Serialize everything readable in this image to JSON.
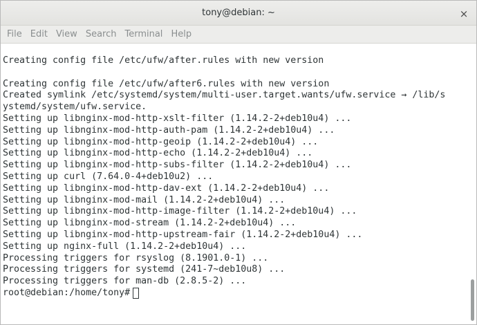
{
  "window": {
    "title": "tony@debian: ~",
    "close_glyph": "×"
  },
  "menu": {
    "items": [
      "File",
      "Edit",
      "View",
      "Search",
      "Terminal",
      "Help"
    ]
  },
  "terminal": {
    "lines": [
      "Creating config file /etc/ufw/after.rules with new version",
      "",
      "Creating config file /etc/ufw/after6.rules with new version",
      "Created symlink /etc/systemd/system/multi-user.target.wants/ufw.service → /lib/s",
      "ystemd/system/ufw.service.",
      "Setting up libnginx-mod-http-xslt-filter (1.14.2-2+deb10u4) ...",
      "Setting up libnginx-mod-http-auth-pam (1.14.2-2+deb10u4) ...",
      "Setting up libnginx-mod-http-geoip (1.14.2-2+deb10u4) ...",
      "Setting up libnginx-mod-http-echo (1.14.2-2+deb10u4) ...",
      "Setting up libnginx-mod-http-subs-filter (1.14.2-2+deb10u4) ...",
      "Setting up curl (7.64.0-4+deb10u2) ...",
      "Setting up libnginx-mod-http-dav-ext (1.14.2-2+deb10u4) ...",
      "Setting up libnginx-mod-mail (1.14.2-2+deb10u4) ...",
      "Setting up libnginx-mod-http-image-filter (1.14.2-2+deb10u4) ...",
      "Setting up libnginx-mod-stream (1.14.2-2+deb10u4) ...",
      "Setting up libnginx-mod-http-upstream-fair (1.14.2-2+deb10u4) ...",
      "Setting up nginx-full (1.14.2-2+deb10u4) ...",
      "Processing triggers for rsyslog (8.1901.0-1) ...",
      "Processing triggers for systemd (241-7~deb10u8) ...",
      "Processing triggers for man-db (2.8.5-2) ..."
    ],
    "prompt": "root@debian:/home/tony#"
  },
  "colors": {
    "text": "#2e3436",
    "menu_text": "#8a8e8f",
    "background": "#ffffff"
  }
}
